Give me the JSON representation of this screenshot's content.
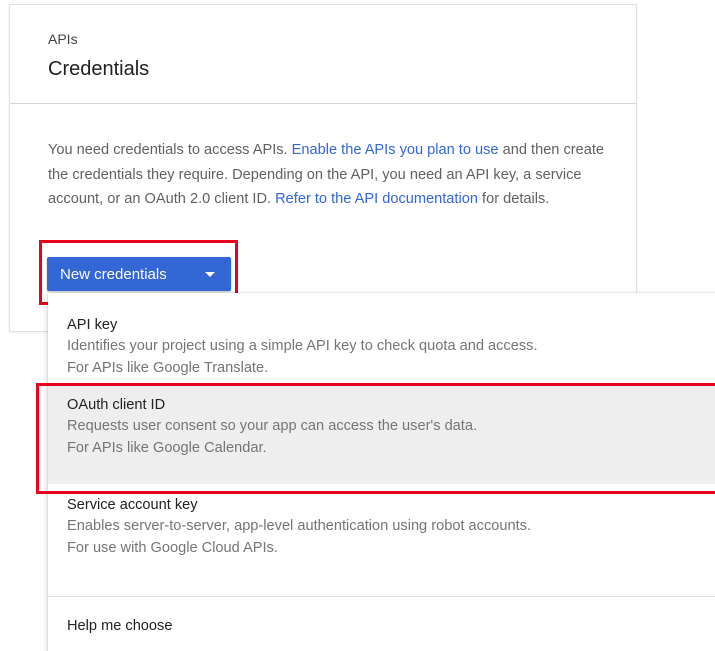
{
  "header": {
    "breadcrumb": "APIs",
    "title": "Credentials"
  },
  "description": {
    "text_1": "You need credentials to access APIs. ",
    "link_1": "Enable the APIs you plan to use",
    "text_2": " and then create the credentials they require. Depending on the API, you need an API key, a service account, or an OAuth 2.0 client ID. ",
    "link_2": "Refer to the API documentation",
    "text_3": " for details."
  },
  "new_credentials_button": {
    "label": "New credentials",
    "icon": "caret-down-icon",
    "color": "#3367d6"
  },
  "menu": {
    "items": [
      {
        "title": "API key",
        "line_1": "Identifies your project using a simple API key to check quota and access.",
        "line_2": "For APIs like Google Translate."
      },
      {
        "title": "OAuth client ID",
        "line_1": "Requests user consent so your app can access the user's data.",
        "line_2": "For APIs like Google Calendar."
      },
      {
        "title": "Service account key",
        "line_1": "Enables server-to-server, app-level authentication using robot accounts.",
        "line_2": "For use with Google Cloud APIs."
      }
    ],
    "help": "Help me choose"
  },
  "highlight_color": "#e8001c",
  "link_color": "#3367d6"
}
